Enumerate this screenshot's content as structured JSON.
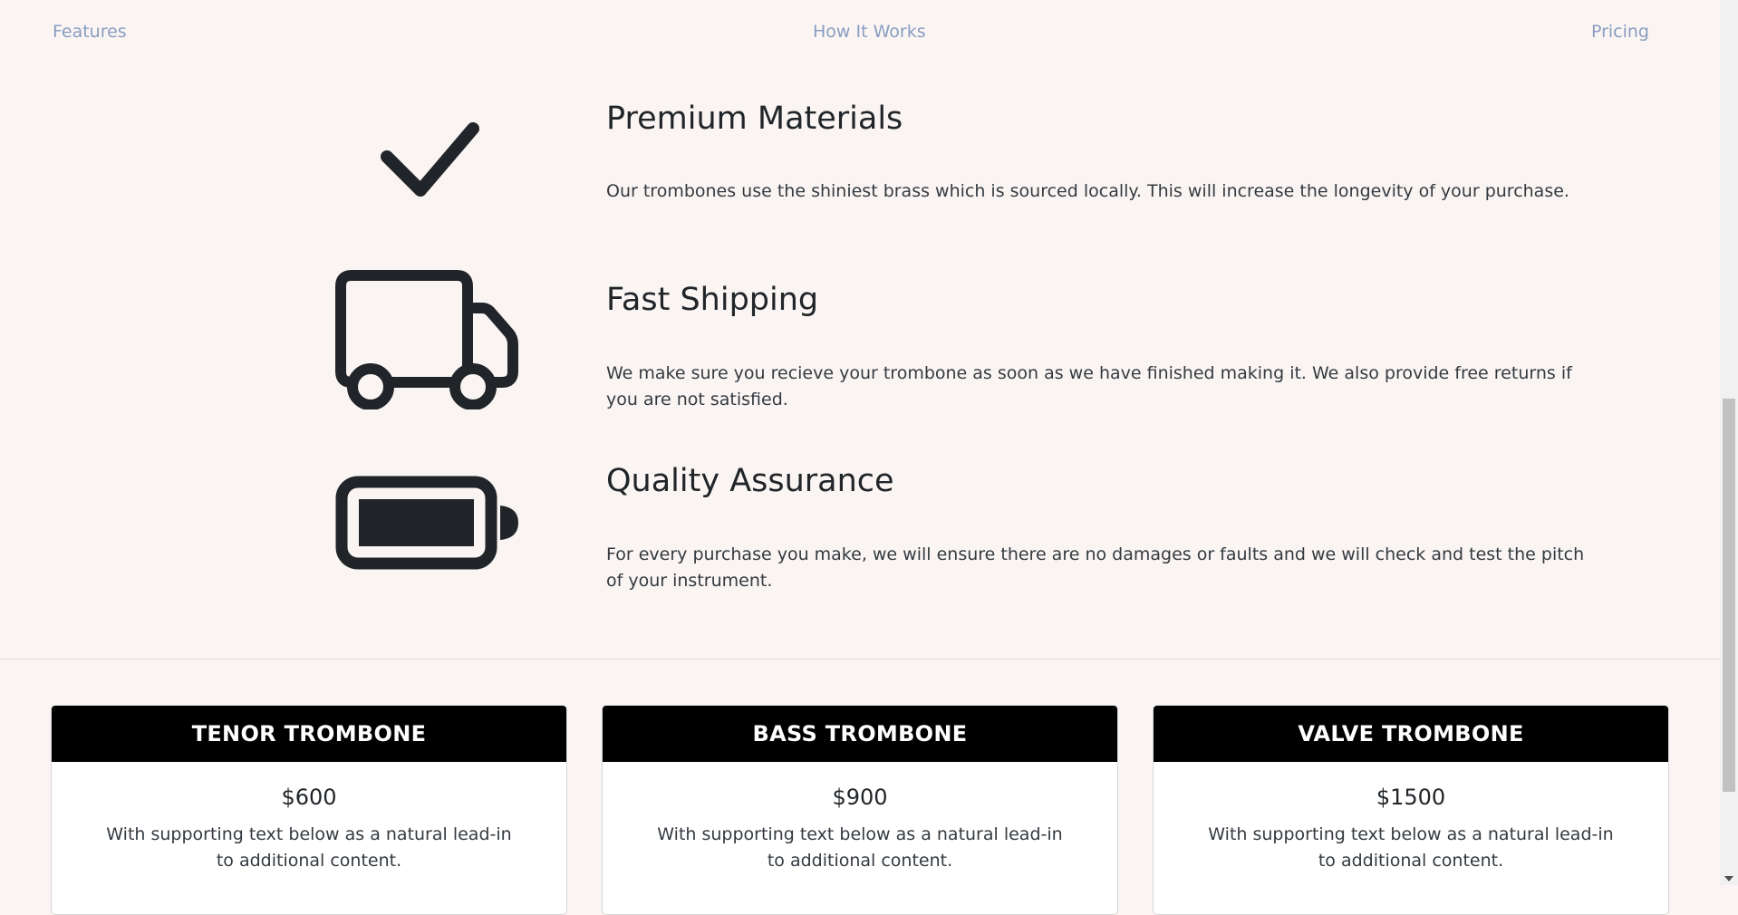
{
  "nav": {
    "features": "Features",
    "how_it_works": "How It Works",
    "pricing": "Pricing"
  },
  "features": [
    {
      "icon": "checkmark-icon",
      "title": "Premium Materials",
      "text": "Our trombones use the shiniest brass which is sourced locally. This will increase the longevity of your purchase."
    },
    {
      "icon": "truck-icon",
      "title": "Fast Shipping",
      "text": "We make sure you recieve your trombone as soon as we have finished making it. We also provide free returns if you are not satisfied."
    },
    {
      "icon": "battery-icon",
      "title": "Quality Assurance",
      "text": "For every purchase you make, we will ensure there are no damages or faults and we will check and test the pitch of your instrument."
    }
  ],
  "pricing": [
    {
      "name": "TENOR TROMBONE",
      "price": "$600",
      "text": "With supporting text below as a natural lead-in to additional content."
    },
    {
      "name": "BASS TROMBONE",
      "price": "$900",
      "text": "With supporting text below as a natural lead-in to additional content."
    },
    {
      "name": "VALVE TROMBONE",
      "price": "$1500",
      "text": "With supporting text below as a natural lead-in to additional content."
    }
  ],
  "colors": {
    "background": "#faf5f3",
    "nav_link": "#8a9dc1",
    "icon": "#212529",
    "card_header": "#000000"
  }
}
